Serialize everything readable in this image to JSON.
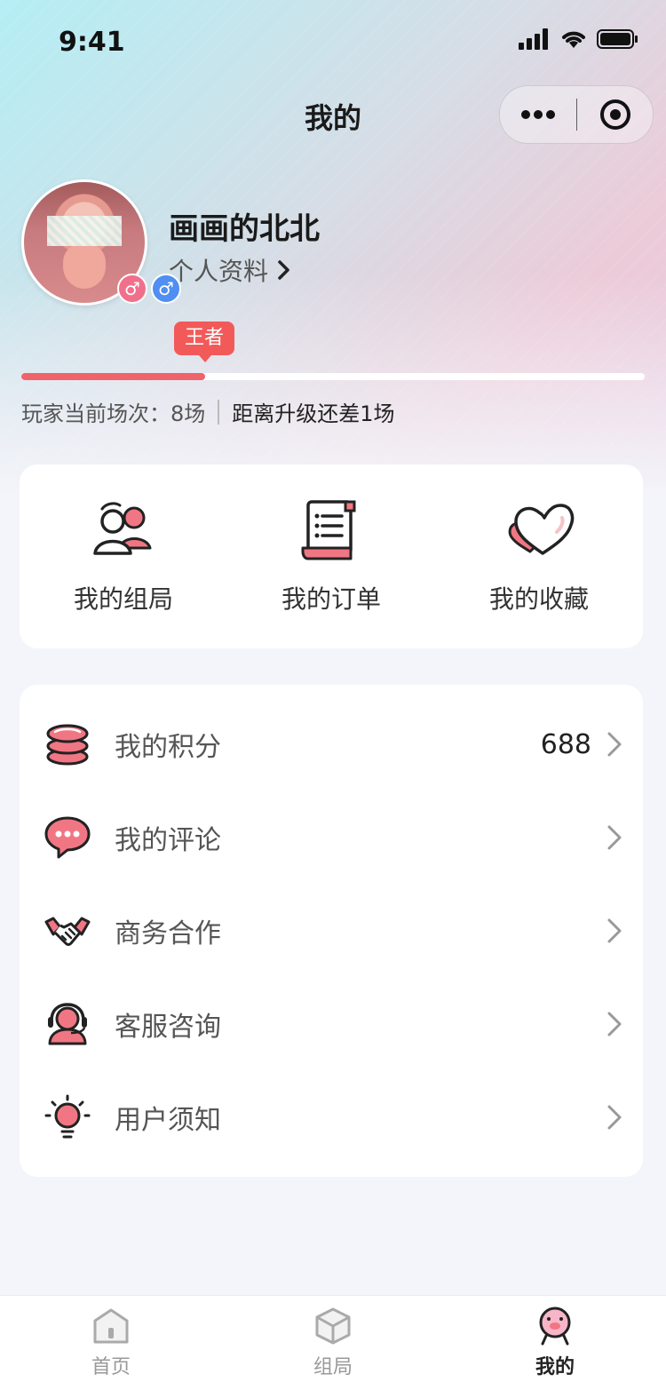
{
  "status_bar": {
    "time": "9:41"
  },
  "nav": {
    "title": "我的"
  },
  "profile": {
    "name": "画画的北北",
    "link_label": "个人资料",
    "gender_badges": [
      "♂",
      "♂"
    ]
  },
  "level": {
    "tag": "王者",
    "progress": 0.295,
    "games_text": "玩家当前场次：8场",
    "next_text": "距离升级还差1场"
  },
  "quick_actions": [
    {
      "label": "我的组局",
      "icon": "group-icon"
    },
    {
      "label": "我的订单",
      "icon": "order-icon"
    },
    {
      "label": "我的收藏",
      "icon": "heart-icon"
    }
  ],
  "menu": [
    {
      "label": "我的积分",
      "value": "688",
      "icon": "coins-icon"
    },
    {
      "label": "我的评论",
      "value": "",
      "icon": "comment-icon"
    },
    {
      "label": "商务合作",
      "value": "",
      "icon": "handshake-icon"
    },
    {
      "label": "客服咨询",
      "value": "",
      "icon": "customer-service-icon"
    },
    {
      "label": "用户须知",
      "value": "",
      "icon": "lightbulb-icon"
    }
  ],
  "tabbar": [
    {
      "label": "首页",
      "icon": "home-icon",
      "active": false
    },
    {
      "label": "组局",
      "icon": "cube-icon",
      "active": false
    },
    {
      "label": "我的",
      "icon": "mine-icon",
      "active": true
    }
  ],
  "colors": {
    "accent": "#f0636a",
    "level_tag": "#f25a5a",
    "gender_female": "#f0708c",
    "gender_male": "#4f8ef2"
  }
}
